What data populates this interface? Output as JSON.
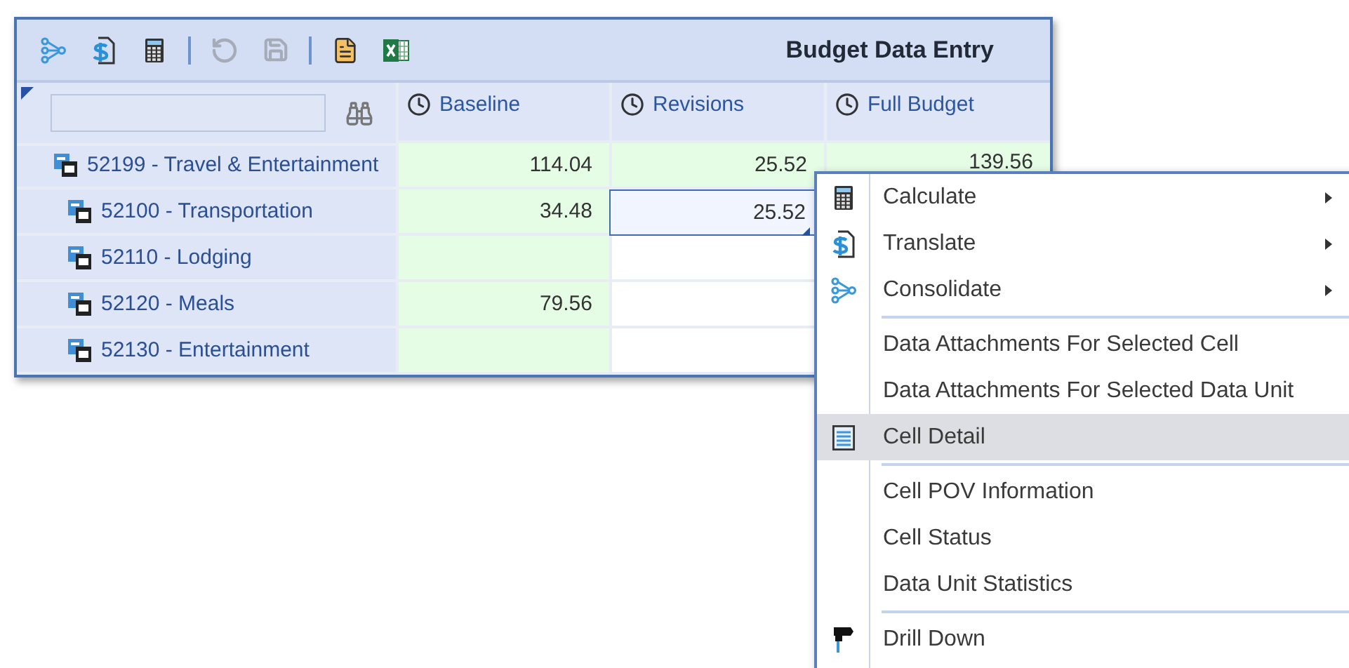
{
  "panel": {
    "title": "Budget Data Entry",
    "toolbar": [
      {
        "kind": "button",
        "disabled": false
      },
      {
        "kind": "button",
        "disabled": false
      },
      {
        "kind": "button",
        "disabled": false
      },
      {
        "kind": "separator"
      },
      {
        "kind": "button",
        "disabled": true
      },
      {
        "kind": "button",
        "disabled": true
      },
      {
        "kind": "separator"
      },
      {
        "kind": "button",
        "disabled": false
      },
      {
        "kind": "button",
        "disabled": false
      }
    ],
    "columns": [
      {
        "label": "Baseline"
      },
      {
        "label": "Revisions"
      },
      {
        "label": "Full Budget"
      }
    ],
    "rows": [
      {
        "label": "52199 - Travel & Entertainment",
        "cells": [
          {
            "value": "114.04",
            "shaded": true,
            "selected": false
          },
          {
            "value": "25.52",
            "shaded": true,
            "selected": false
          },
          {
            "value": "139.56",
            "shaded": true,
            "selected": false
          }
        ],
        "children": [
          {
            "label": "52100 - Transportation",
            "cells": [
              {
                "value": "34.48",
                "shaded": true,
                "selected": false
              },
              {
                "value": "25.52",
                "shaded": false,
                "selected": true
              }
            ]
          },
          {
            "label": "52110 - Lodging",
            "cells": [
              {
                "shaded": true,
                "selected": false
              },
              {
                "shaded": false,
                "selected": false
              }
            ]
          },
          {
            "label": "52120 - Meals",
            "cells": [
              {
                "value": "79.56",
                "shaded": true,
                "selected": false
              },
              {
                "shaded": false,
                "selected": false
              }
            ]
          },
          {
            "label": "52130 - Entertainment",
            "cells": [
              {
                "shaded": true,
                "selected": false
              },
              {
                "shaded": false,
                "selected": false
              }
            ]
          }
        ]
      }
    ]
  },
  "context_menu": {
    "items": [
      {
        "kind": "item",
        "label": "Calculate",
        "submenu": true,
        "selected": false
      },
      {
        "kind": "item",
        "label": "Translate",
        "submenu": true,
        "selected": false
      },
      {
        "kind": "item",
        "label": "Consolidate",
        "submenu": true,
        "selected": false
      },
      {
        "kind": "separator"
      },
      {
        "kind": "item",
        "label": "Data Attachments For Selected Cell",
        "submenu": false,
        "selected": false
      },
      {
        "kind": "item",
        "label": "Data Attachments For Selected Data Unit",
        "submenu": false,
        "selected": false
      },
      {
        "kind": "item",
        "label": "Cell Detail",
        "submenu": false,
        "selected": true
      },
      {
        "kind": "separator"
      },
      {
        "kind": "item",
        "label": "Cell POV Information",
        "submenu": false,
        "selected": false
      },
      {
        "kind": "item",
        "label": "Cell Status",
        "submenu": false,
        "selected": false
      },
      {
        "kind": "item",
        "label": "Data Unit Statistics",
        "submenu": false,
        "selected": false
      },
      {
        "kind": "separator"
      },
      {
        "kind": "item",
        "label": "Drill Down",
        "submenu": false,
        "selected": false
      }
    ]
  }
}
